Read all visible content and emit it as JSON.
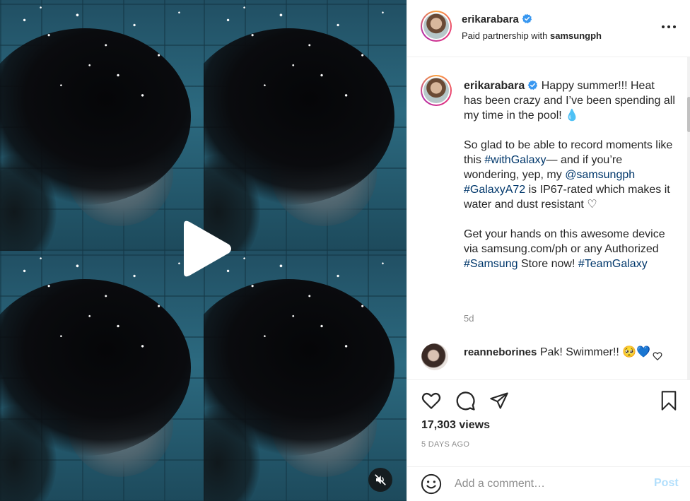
{
  "media": {
    "play_icon": "play-icon",
    "mute_icon": "speaker-muted-icon"
  },
  "header": {
    "username": "erikarabara",
    "partner_prefix": "Paid partnership with ",
    "partner_name": "samsungph",
    "more_icon": "more-horizontal-icon"
  },
  "caption": {
    "username": "erikarabara",
    "p1_text": " Happy summer!!! Heat has been crazy and I’ve been spending all my time in the pool! ",
    "p1_emoji": "💧",
    "p2_a": "So glad to be able to record moments like this ",
    "p2_tag1": "#withGalaxy",
    "p2_b": "— and if you’re wondering, yep, my ",
    "p2_mention": "@samsungph",
    "p2_c": " ",
    "p2_tag2": "#GalaxyA72",
    "p2_d": " is IP67-rated which makes it water and dust resistant ",
    "p2_emoji": "♡",
    "p3_a": "Get your hands on this awesome device via samsung.com/ph or any Authorized ",
    "p3_tag1": "#Samsung",
    "p3_b": " Store now! ",
    "p3_tag2": "#TeamGalaxy",
    "time": "5d"
  },
  "comment": {
    "username": "reanneborines",
    "text": " Pak! Swimmer!! ",
    "emojis": "🥺💙"
  },
  "actions": {
    "views": "17,303 views",
    "posted": "5 DAYS AGO"
  },
  "add_comment": {
    "placeholder": "Add a comment…",
    "post_label": "Post"
  },
  "colors": {
    "link": "#00376b",
    "post_disabled": "#b2dffc",
    "verified": "#3897f0",
    "secondary_text": "#8e8e8e"
  }
}
